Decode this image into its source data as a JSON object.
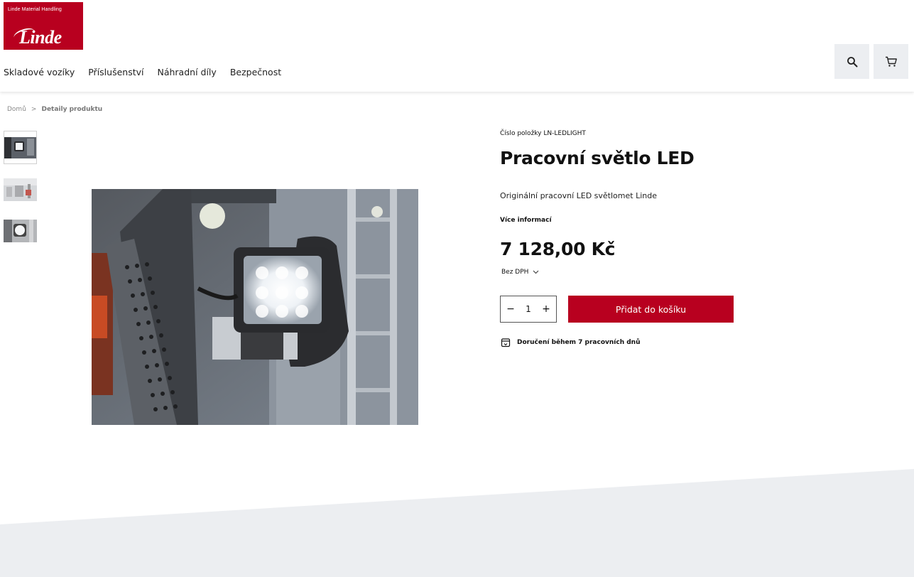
{
  "brand": {
    "tagline": "Linde Material Handling",
    "name": "Linde",
    "color": "#b8001f"
  },
  "nav": {
    "items": [
      {
        "label": "Skladové vozíky"
      },
      {
        "label": "Příslušenství"
      },
      {
        "label": "Náhradní díly"
      },
      {
        "label": "Bezpečnost"
      }
    ]
  },
  "header_icons": {
    "search": "search-icon",
    "cart": "cart-icon"
  },
  "breadcrumb": {
    "home": "Domů",
    "separator": ">",
    "current": "Detaily produktu"
  },
  "product": {
    "sku": "Číslo položky LN-LEDLIGHT",
    "title": "Pracovní světlo LED",
    "description": "Originální pracovní LED světlomet Linde",
    "more_info": "Více informací",
    "price": "7 128,00 Kč",
    "vat_label": "Bez DPH",
    "quantity": "1",
    "add_to_cart": "Přidat do košíku",
    "delivery": "Doručení během 7 pracovních dnů",
    "thumbnail_count": 3
  },
  "colors": {
    "accent": "#b8001f",
    "icon_button_bg": "#eceef1",
    "footer_band": "#eceef1"
  }
}
